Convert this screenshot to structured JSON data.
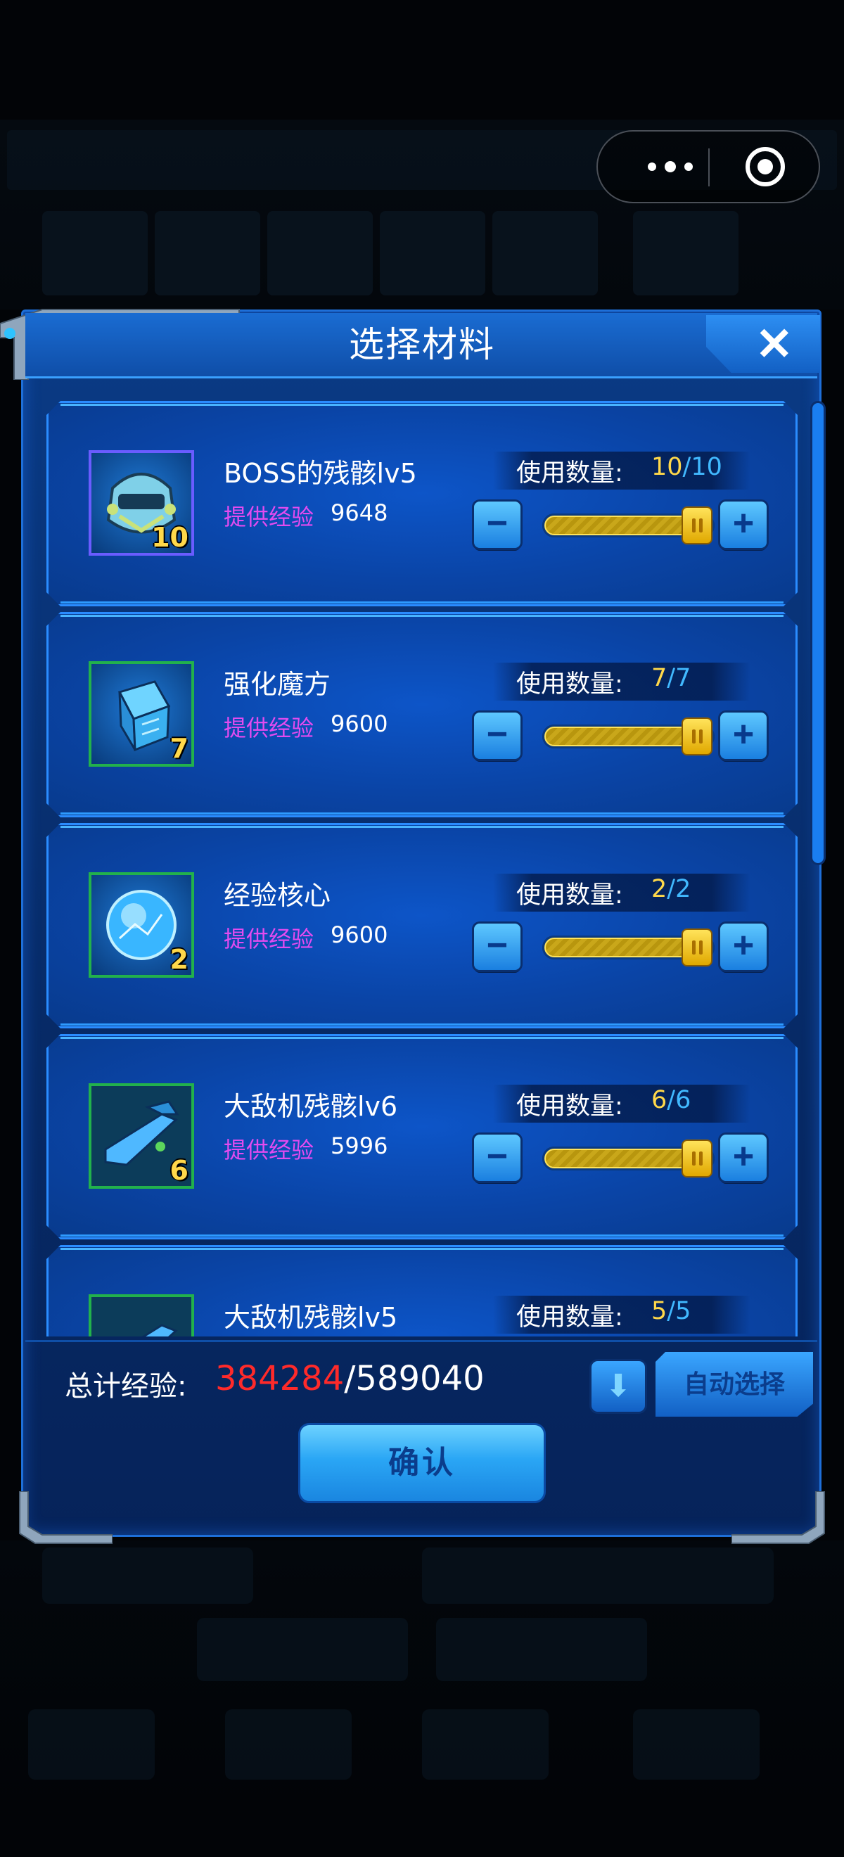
{
  "capsule": {
    "menu_icon": "more-dots-icon",
    "close_icon": "target-circle-icon"
  },
  "dialog": {
    "title": "选择材料",
    "close_icon": "✕",
    "items": [
      {
        "name": "BOSS的残骸lv5",
        "exp_label": "提供经验",
        "exp": "9648",
        "qty_label": "使用数量:",
        "qty_current": "10",
        "qty_max": "/10",
        "badge": "10",
        "icon": "boss-helmet-icon",
        "frame": "purple",
        "fill": 1.0
      },
      {
        "name": "强化魔方",
        "exp_label": "提供经验",
        "exp": "9600",
        "qty_label": "使用数量:",
        "qty_current": "7",
        "qty_max": "/7",
        "badge": "7",
        "icon": "cube-icon",
        "frame": "green",
        "fill": 1.0
      },
      {
        "name": "经验核心",
        "exp_label": "提供经验",
        "exp": "9600",
        "qty_label": "使用数量:",
        "qty_current": "2",
        "qty_max": "/2",
        "badge": "2",
        "icon": "energy-orb-icon",
        "frame": "green",
        "fill": 1.0
      },
      {
        "name": "大敌机残骸lv6",
        "exp_label": "提供经验",
        "exp": "5996",
        "qty_label": "使用数量:",
        "qty_current": "6",
        "qty_max": "/6",
        "badge": "6",
        "icon": "ship-wreck-icon",
        "frame": "green",
        "fill": 1.0
      },
      {
        "name": "大敌机残骸lv5",
        "exp_label": "",
        "exp": "",
        "qty_label": "使用数量:",
        "qty_current": "5",
        "qty_max": "/5",
        "badge": "",
        "icon": "ship-wreck-icon",
        "frame": "green",
        "fill": 1.0
      }
    ],
    "minus_label": "−",
    "plus_label": "+",
    "footer": {
      "total_label": "总计经验:",
      "total_current": "384284",
      "total_max": "/589040",
      "down_icon": "⬇",
      "auto_select": "自动选择",
      "confirm": "确认"
    }
  },
  "colors": {
    "accent": "#1e6fd8",
    "exp_label": "#e34bf0",
    "qty_current": "#ffd84a",
    "qty_max": "#41b9ff",
    "total_current": "#ff2a2a"
  }
}
